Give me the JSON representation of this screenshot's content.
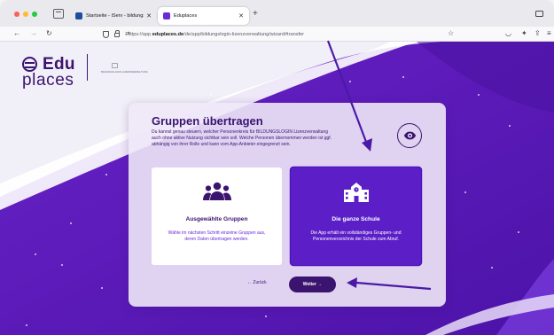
{
  "browser": {
    "tabs": [
      {
        "title": "Startseite - iServ - bildungslogi",
        "active": false
      },
      {
        "title": "Eduplaces",
        "active": true
      }
    ],
    "new_tab_label": "+",
    "url": {
      "prefix": "https://app.",
      "domain": "eduplaces.de",
      "path": "/de/app/bildungslogin-lizenzverwaltung/wizard#transfer"
    }
  },
  "header": {
    "logo_top": "Edu",
    "logo_bottom": "places",
    "partner_logo_text": "BILDUNGSLOGIN LIZENZVERWALTUNG"
  },
  "card": {
    "title": "Gruppen übertragen",
    "description": "Du kannst genau steuern, welcher Personenkreis für BILDUNGSLOGIN Lizenzverwaltung auch ohne aktive Nutzung sichtbar sein soll. Welche Personen übernommen werden ist ggf. abhängig von ihrer Rolle und kann vom App-Anbieter eingegrenzt sein.",
    "options": [
      {
        "icon": "users-group-icon",
        "label": "Ausgewählte Gruppen",
        "description": "Wähle im nächsten Schritt einzelne Gruppen aus, deren Daten übertragen werden.",
        "selected": false
      },
      {
        "icon": "school-icon",
        "label": "Die ganze Schule",
        "description": "Die App erhält ein vollständiges Gruppen- und Personenverzeichnis der Schule zum Abruf.",
        "selected": true
      }
    ],
    "back_label": "← Zurück",
    "next_label": "Weiter →"
  },
  "colors": {
    "brand_dark": "#3b1470",
    "brand_purple": "#5b1ec7",
    "background_purple": "#5a17b0",
    "annotation_arrow": "#4a1aa6"
  }
}
